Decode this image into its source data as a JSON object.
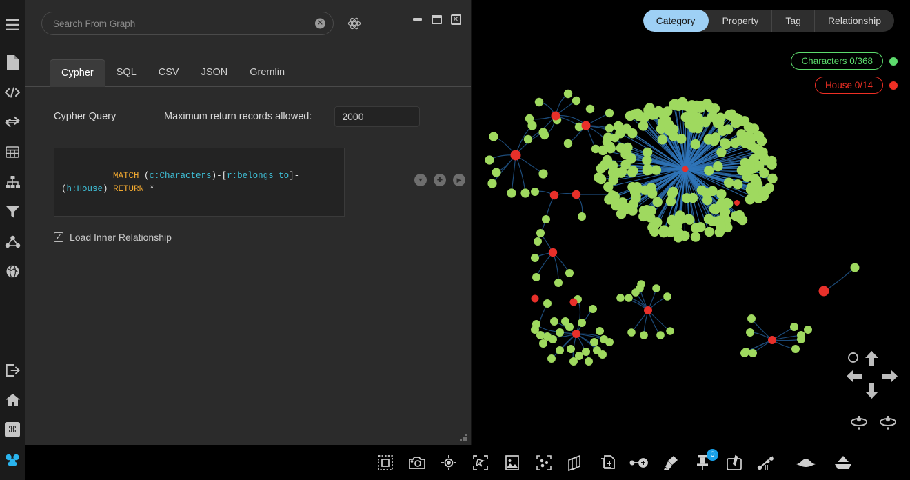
{
  "sidebar": {
    "items": [
      {
        "name": "menu-icon",
        "label": "Menu"
      },
      {
        "name": "document-icon",
        "label": "Document"
      },
      {
        "name": "code-icon",
        "label": "Code"
      },
      {
        "name": "transfer-icon",
        "label": "Transfer"
      },
      {
        "name": "table-icon",
        "label": "Table"
      },
      {
        "name": "hierarchy-icon",
        "label": "Hierarchy"
      },
      {
        "name": "filter-icon",
        "label": "Filter"
      },
      {
        "name": "network-icon",
        "label": "Network"
      },
      {
        "name": "globe-icon",
        "label": "Globe"
      }
    ],
    "bottom_items": [
      {
        "name": "export-icon",
        "label": "Export"
      },
      {
        "name": "home-icon",
        "label": "Home"
      },
      {
        "name": "command-icon",
        "label": "Command",
        "glyph": "⌘"
      },
      {
        "name": "users-icon",
        "label": "Users"
      }
    ]
  },
  "search": {
    "placeholder": "Search From Graph",
    "value": "",
    "clear_glyph": "✕",
    "molecule_icon": "molecule-icon"
  },
  "window_controls": {
    "minimize": "minimize-button",
    "maximize": "maximize-button",
    "close": "close-button",
    "close_glyph": "✕"
  },
  "tabs": [
    {
      "label": "Cypher",
      "active": true
    },
    {
      "label": "SQL",
      "active": false
    },
    {
      "label": "CSV",
      "active": false
    },
    {
      "label": "JSON",
      "active": false
    },
    {
      "label": "Gremlin",
      "active": false
    }
  ],
  "query": {
    "section_label": "Cypher Query",
    "max_records_label": "Maximum return records allowed:",
    "max_records_value": "2000",
    "text": "MATCH (c:Characters)-[r:belongs_to]-(h:House) RETURN *",
    "tokens": [
      {
        "t": "MATCH",
        "k": "kw"
      },
      {
        "t": " (",
        "k": "punct"
      },
      {
        "t": "c:Characters",
        "k": "var"
      },
      {
        "t": ")-[",
        "k": "punct"
      },
      {
        "t": "r:belongs_to",
        "k": "var"
      },
      {
        "t": "]-(",
        "k": "punct"
      },
      {
        "t": "h:House",
        "k": "var"
      },
      {
        "t": ") ",
        "k": "punct"
      },
      {
        "t": "RETURN",
        "k": "kw"
      },
      {
        "t": " *",
        "k": "punct"
      }
    ],
    "buttons": [
      {
        "name": "collapse-button",
        "glyph": "▾"
      },
      {
        "name": "add-query-button",
        "glyph": "✚"
      },
      {
        "name": "run-query-button",
        "glyph": "▶"
      }
    ],
    "checkbox": {
      "label": "Load Inner Relationship",
      "checked": true,
      "glyph": "✓"
    }
  },
  "graph_panel": {
    "segmented_tabs": [
      {
        "label": "Category",
        "active": true
      },
      {
        "label": "Property",
        "active": false
      },
      {
        "label": "Tag",
        "active": false
      },
      {
        "label": "Relationship",
        "active": false
      }
    ],
    "legend": [
      {
        "label": "Characters 0/368",
        "color": "#5ddb6d"
      },
      {
        "label": "House 0/14",
        "color": "#ee2f24"
      }
    ],
    "navigation": {
      "up": "pan-up-button",
      "down": "pan-down-button",
      "left": "pan-left-button",
      "right": "pan-right-button",
      "center": "recenter-button",
      "rotate_left": "rotate-left-button",
      "rotate_right": "rotate-right-button"
    },
    "node_colors": {
      "character": "#9fd95f",
      "house": "#e8302a",
      "edge": "#1c4a78"
    }
  },
  "toolbar": {
    "items": [
      {
        "name": "select-box-tool",
        "label": "Box Select"
      },
      {
        "name": "camera-tool",
        "label": "Snapshot"
      },
      {
        "name": "target-tool",
        "label": "Focus"
      },
      {
        "name": "lasso-tool",
        "label": "Lasso Select"
      },
      {
        "name": "image-tool",
        "label": "Background Image"
      },
      {
        "name": "cluster-tool",
        "label": "Cluster Select"
      },
      {
        "name": "box3d-tool",
        "label": "3D Box"
      },
      {
        "name": "add-node-tool",
        "label": "Add Node"
      },
      {
        "name": "add-edge-tool",
        "label": "Add Edge"
      },
      {
        "name": "brush-tool",
        "label": "Clear Brush"
      },
      {
        "name": "pin-tool",
        "label": "Pinned Items",
        "badge": "0"
      },
      {
        "name": "pen-tool",
        "label": "Annotate"
      },
      {
        "name": "cut-tool",
        "label": "Cut Edges"
      }
    ],
    "right_items": [
      {
        "name": "collapse-layer-tool",
        "label": "Collapse"
      },
      {
        "name": "expand-layer-tool",
        "label": "Expand"
      }
    ]
  }
}
